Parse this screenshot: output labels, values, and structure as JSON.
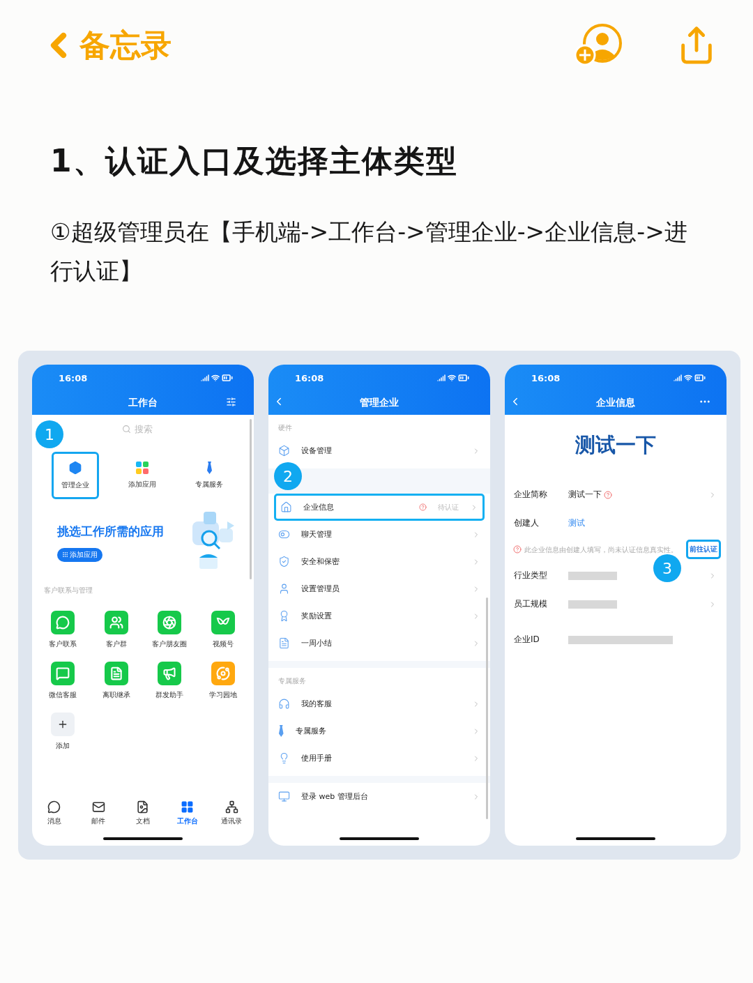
{
  "nav": {
    "back": "备忘录"
  },
  "note": {
    "heading": "1、认证入口及选择主体类型",
    "body": "①超级管理员在【手机端->工作台->管理企业->企业信息->进行认证】"
  },
  "screens": [
    {
      "kind": "workbench",
      "time": "16:08",
      "title": "工作台",
      "step": "1",
      "search": {
        "placeholder": "搜索"
      },
      "shortcuts": [
        {
          "label": "管理企业",
          "selected": true
        },
        {
          "label": "添加应用",
          "selected": false
        },
        {
          "label": "专属服务",
          "selected": false
        }
      ],
      "banner": {
        "title": "挑选工作所需的应用",
        "button": "添加应用"
      },
      "section": "客户联系与管理",
      "apps": [
        {
          "label": "客户联系",
          "color": "#16c94a"
        },
        {
          "label": "客户群",
          "color": "#16c94a"
        },
        {
          "label": "客户朋友圈",
          "color": "#16c94a"
        },
        {
          "label": "视频号",
          "color": "#16c94a"
        },
        {
          "label": "微信客服",
          "color": "#16c94a"
        },
        {
          "label": "离职继承",
          "color": "#16c94a"
        },
        {
          "label": "群发助手",
          "color": "#16c94a"
        },
        {
          "label": "学习园地",
          "color": "#ffa80f"
        }
      ],
      "add_label": "添加",
      "tabs": [
        {
          "label": "消息",
          "selected": false
        },
        {
          "label": "邮件",
          "selected": false
        },
        {
          "label": "文档",
          "selected": false
        },
        {
          "label": "工作台",
          "selected": true
        },
        {
          "label": "通讯录",
          "selected": false
        }
      ]
    },
    {
      "kind": "manage",
      "time": "16:08",
      "title": "管理企业",
      "step": "2",
      "groups": [
        {
          "title": "硬件",
          "items": [
            {
              "label": "设备管理",
              "selected": false
            }
          ]
        },
        {
          "items": [
            {
              "label": "企业信息",
              "badge": "待认证",
              "selected": true
            },
            {
              "label": "聊天管理",
              "selected": false
            },
            {
              "label": "安全和保密",
              "selected": false
            },
            {
              "label": "设置管理员",
              "selected": false
            },
            {
              "label": "奖励设置",
              "selected": false
            },
            {
              "label": "一周小结",
              "selected": false
            }
          ]
        },
        {
          "title": "专属服务",
          "items": [
            {
              "label": "我的客服",
              "selected": false
            },
            {
              "label": "专属服务",
              "selected": false
            },
            {
              "label": "使用手册",
              "selected": false
            }
          ]
        },
        {
          "items": [
            {
              "label": "登录 web 管理后台",
              "selected": false
            }
          ]
        }
      ]
    },
    {
      "kind": "info",
      "time": "16:08",
      "title": "企业信息",
      "step": "3",
      "company": "测试一下",
      "rows": [
        {
          "kind": "text",
          "label": "企业简称",
          "value": "测试一下",
          "warning": true,
          "chevron": true
        },
        {
          "kind": "link",
          "label": "创建人",
          "value": "测试",
          "warning": false,
          "chevron": false
        },
        {
          "kind": "notice",
          "text": "此企业信息由创建人填写，尚未认证信息真实性。",
          "link": "前往认证",
          "selected": true
        },
        {
          "kind": "redacted",
          "label": "行业类型",
          "wide": false,
          "chevron": true
        },
        {
          "kind": "redacted",
          "label": "员工规模",
          "wide": false,
          "chevron": true
        },
        {
          "kind": "redacted",
          "label": "企业ID",
          "wide": true,
          "chevron": false
        }
      ]
    }
  ]
}
